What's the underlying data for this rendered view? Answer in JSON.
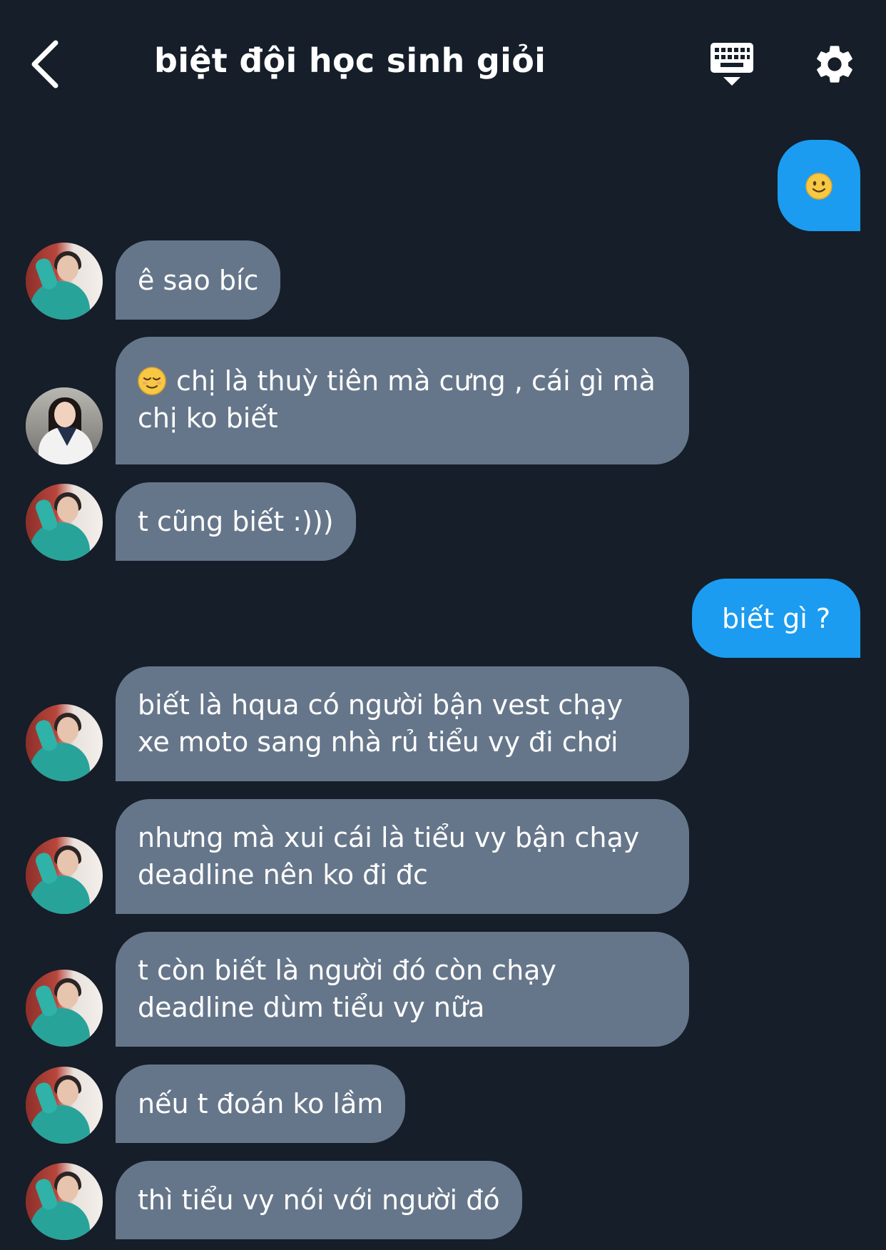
{
  "header": {
    "title": "biệt đội học sinh giỏi",
    "back_icon": "chevron-left-icon",
    "keyboard_icon": "keyboard-icon",
    "settings_icon": "gear-icon"
  },
  "colors": {
    "background": "#151e29",
    "incoming_bubble": "#66768a",
    "outgoing_bubble": "#1b9cf0",
    "text": "#ffffff"
  },
  "messages": [
    {
      "direction": "out",
      "emoji": "slightly-smiling-face"
    },
    {
      "direction": "in",
      "avatar": "avatar-teal-dress",
      "lines": [
        "ê sao bíc"
      ]
    },
    {
      "direction": "in",
      "avatar": "avatar-white-sweater",
      "emoji": "relieved-face",
      "lines": [
        "chị là thuỳ tiên mà cưng , cái gì mà",
        "chị ko biết"
      ]
    },
    {
      "direction": "in",
      "avatar": "avatar-teal-dress",
      "lines": [
        "t cũng biết :)))"
      ]
    },
    {
      "direction": "out",
      "lines": [
        "biết gì ?"
      ]
    },
    {
      "direction": "in",
      "avatar": "avatar-teal-dress",
      "lines": [
        "biết là hqua có người bận vest chạy",
        "xe moto sang nhà rủ tiểu vy đi chơi"
      ]
    },
    {
      "direction": "in",
      "avatar": "avatar-teal-dress",
      "lines": [
        "nhưng mà xui cái là tiểu vy bận chạy",
        "deadline nên ko đi đc"
      ]
    },
    {
      "direction": "in",
      "avatar": "avatar-teal-dress",
      "lines": [
        "t còn biết là người đó còn chạy",
        "deadline dùm tiểu vy nữa"
      ]
    },
    {
      "direction": "in",
      "avatar": "avatar-teal-dress",
      "lines": [
        "nếu t đoán ko lầm"
      ]
    },
    {
      "direction": "in",
      "avatar": "avatar-teal-dress",
      "lines": [
        "thì tiểu vy nói với người đó"
      ]
    }
  ]
}
